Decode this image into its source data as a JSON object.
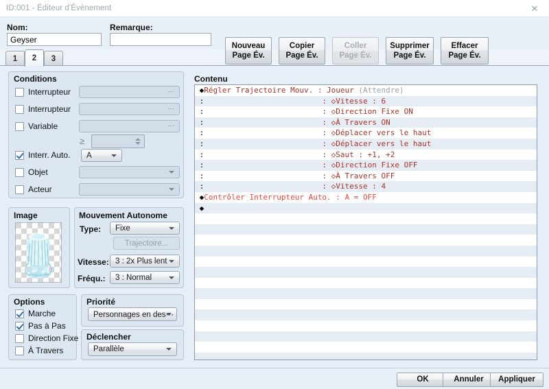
{
  "window": {
    "title": "ID:001 - Éditeur d'Évènement",
    "close_icon": "close-icon"
  },
  "header": {
    "name_label": "Nom:",
    "name_value": "Geyser",
    "note_label": "Remarque:",
    "note_value": "",
    "note_placeholder": "",
    "buttons": [
      {
        "line1": "Nouveau",
        "line2": "Page Év.",
        "disabled": false
      },
      {
        "line1": "Copier",
        "line2": "Page Év.",
        "disabled": false
      },
      {
        "line1": "Coller",
        "line2": "Page Év.",
        "disabled": true
      },
      {
        "line1": "Supprimer",
        "line2": "Page Év.",
        "disabled": false
      },
      {
        "line1": "Effacer",
        "line2": "Page Év.",
        "disabled": false
      }
    ]
  },
  "tabs": {
    "items": [
      "1",
      "2",
      "3"
    ],
    "active_index": 1
  },
  "conditions": {
    "title": "Conditions",
    "rows": [
      {
        "label": "Interrupteur",
        "checked": false,
        "field_kind": "dots",
        "value": ""
      },
      {
        "label": "Interrupteur",
        "checked": false,
        "field_kind": "dots",
        "value": ""
      },
      {
        "label": "Variable",
        "checked": false,
        "field_kind": "dots",
        "value": ""
      }
    ],
    "operator": "≥",
    "operator_value": "",
    "auto_switch": {
      "label": "Interr. Auto.",
      "checked": true,
      "value": "A"
    },
    "object": {
      "label": "Objet",
      "checked": false,
      "value": ""
    },
    "actor": {
      "label": "Acteur",
      "checked": false,
      "value": ""
    }
  },
  "image": {
    "title": "Image",
    "sprite_name": "geyser-sprite"
  },
  "autonomous": {
    "title": "Mouvement Autonome",
    "type_label": "Type:",
    "type_value": "Fixe",
    "route_button": "Trajectoire...",
    "route_button_disabled": true,
    "speed_label": "Vitesse:",
    "speed_value": "3 : 2x Plus lent",
    "freq_label": "Fréqu.:",
    "freq_value": "3 : Normal"
  },
  "options": {
    "title": "Options",
    "items": [
      {
        "label": "Marche",
        "checked": true
      },
      {
        "label": "Pas à Pas",
        "checked": true
      },
      {
        "label": "Direction Fixe",
        "checked": false
      },
      {
        "label": "À Travers",
        "checked": false
      }
    ]
  },
  "priority": {
    "title": "Priorité",
    "value": "Personnages en des⋯"
  },
  "trigger": {
    "title": "Déclencher",
    "value": "Parallèle"
  },
  "content": {
    "title": "Contenu",
    "total_rows": 26,
    "lines": [
      {
        "marker": "◆",
        "indent": 0,
        "text": "Régler Trajectoire Mouv. : Joueur ",
        "suffix": "(Attendre)",
        "style": "dark"
      },
      {
        "marker": ":",
        "indent": 1,
        "text": ": ◇Vitesse : 6",
        "suffix": "",
        "style": "dark"
      },
      {
        "marker": ":",
        "indent": 1,
        "text": ": ◇Direction Fixe ON",
        "suffix": "",
        "style": "dark"
      },
      {
        "marker": ":",
        "indent": 1,
        "text": ": ◇À Travers ON",
        "suffix": "",
        "style": "dark"
      },
      {
        "marker": ":",
        "indent": 1,
        "text": ": ◇Déplacer vers le haut",
        "suffix": "",
        "style": "dark"
      },
      {
        "marker": ":",
        "indent": 1,
        "text": ": ◇Déplacer vers le haut",
        "suffix": "",
        "style": "dark"
      },
      {
        "marker": ":",
        "indent": 1,
        "text": ": ◇Saut : +1, +2",
        "suffix": "",
        "style": "dark"
      },
      {
        "marker": ":",
        "indent": 1,
        "text": ": ◇Direction Fixe OFF",
        "suffix": "",
        "style": "dark"
      },
      {
        "marker": ":",
        "indent": 1,
        "text": ": ◇À Travers OFF",
        "suffix": "",
        "style": "dark"
      },
      {
        "marker": ":",
        "indent": 1,
        "text": ": ◇Vitesse : 4",
        "suffix": "",
        "style": "dark"
      },
      {
        "marker": "◆",
        "indent": 0,
        "text": "Contrôler Interrupteur Auto. : A = OFF",
        "suffix": "",
        "style": "bright"
      },
      {
        "marker": "◆",
        "indent": 0,
        "text": "",
        "suffix": "",
        "style": "dark"
      }
    ]
  },
  "footer": {
    "ok": "OK",
    "cancel": "Annuler",
    "apply": "Appliquer"
  }
}
